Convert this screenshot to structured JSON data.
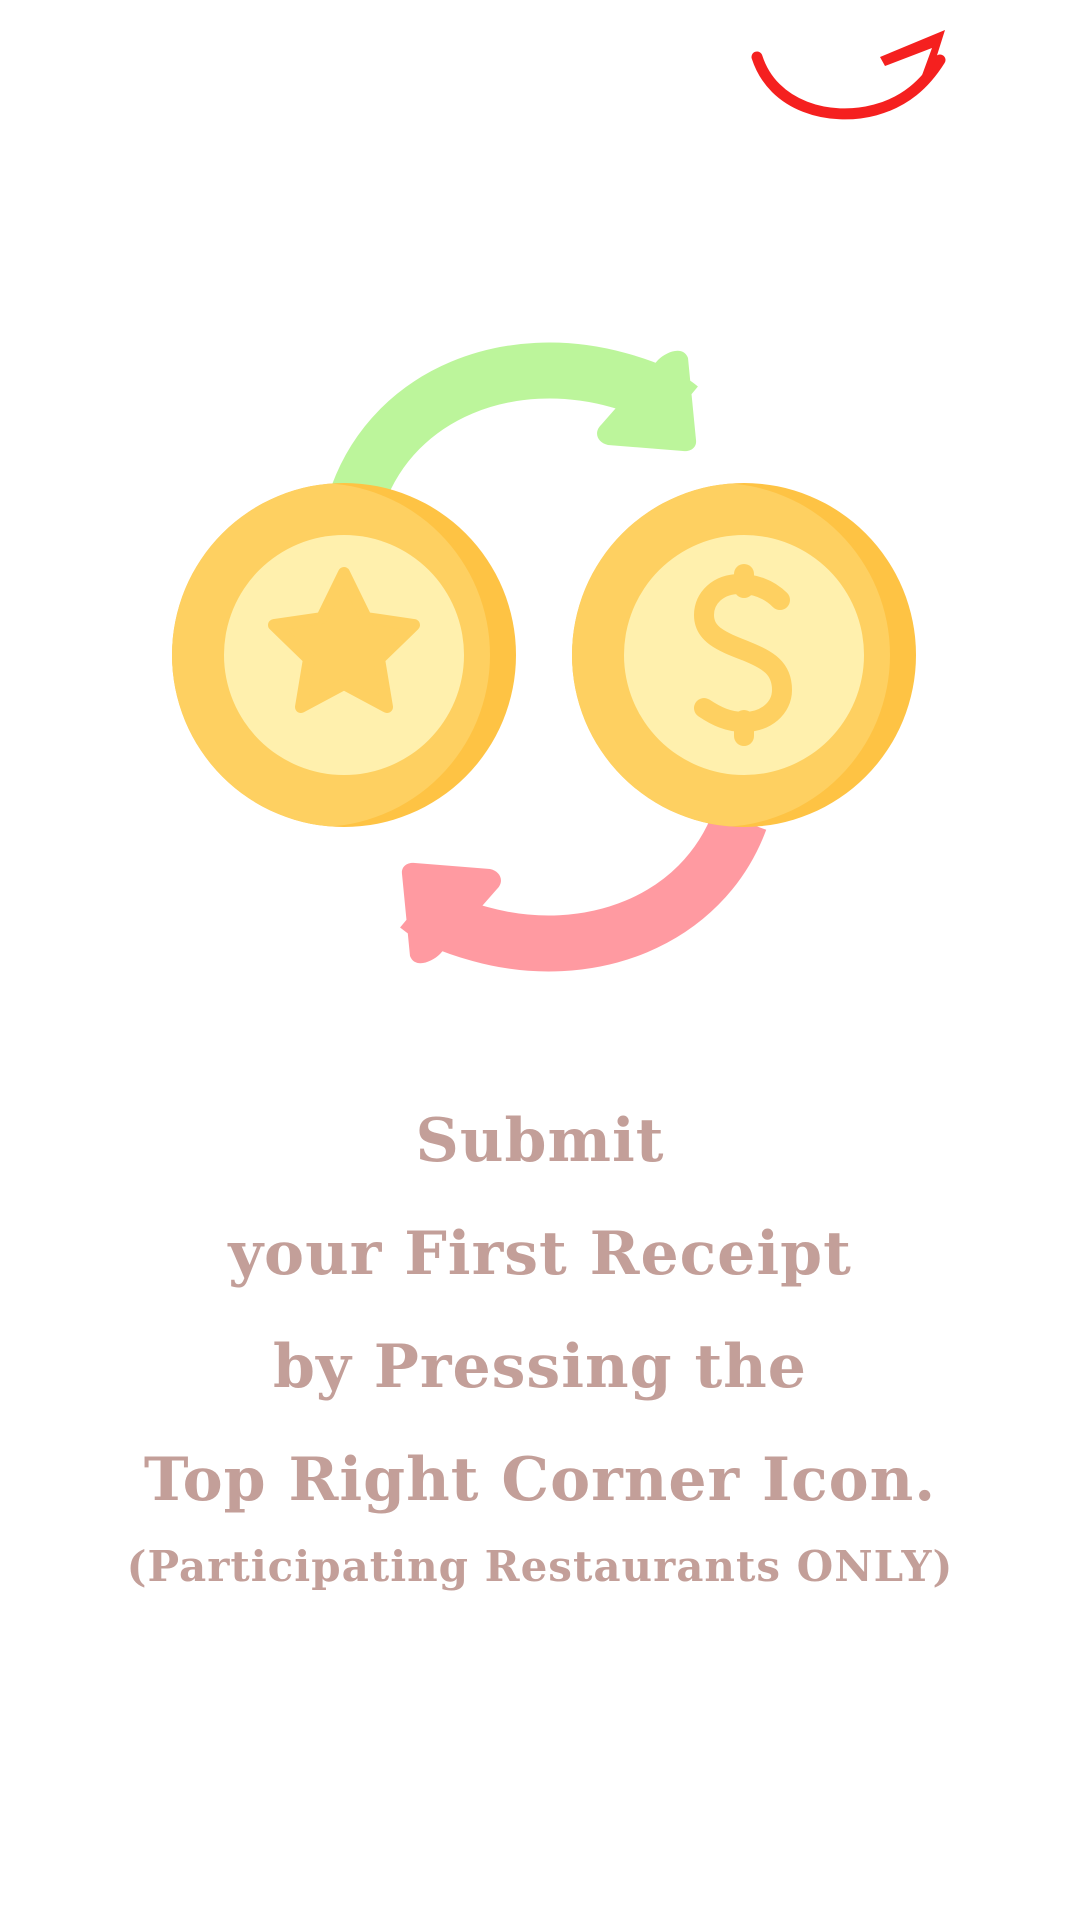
{
  "instruction": {
    "lines": [
      "Submit",
      "your First Receipt",
      "by Pressing the",
      "Top Right Corner Icon."
    ],
    "note": "(Participating Restaurants ONLY)"
  },
  "icons": {
    "pointer": "curved-arrow-up-right-icon",
    "illustration": "coin-exchange-icon",
    "reward_coin": "star-coin-icon",
    "cash_coin": "dollar-coin-icon"
  },
  "colors": {
    "text": "#c39f99",
    "pointer_arrow": "#f5201f",
    "coin_outer": "#fed061",
    "coin_shade": "#fec344",
    "coin_inner": "#fff0ad",
    "coin_symbol": "#fed061",
    "arrow_green": "#bcf59b",
    "arrow_pink": "#ff9aa1"
  }
}
